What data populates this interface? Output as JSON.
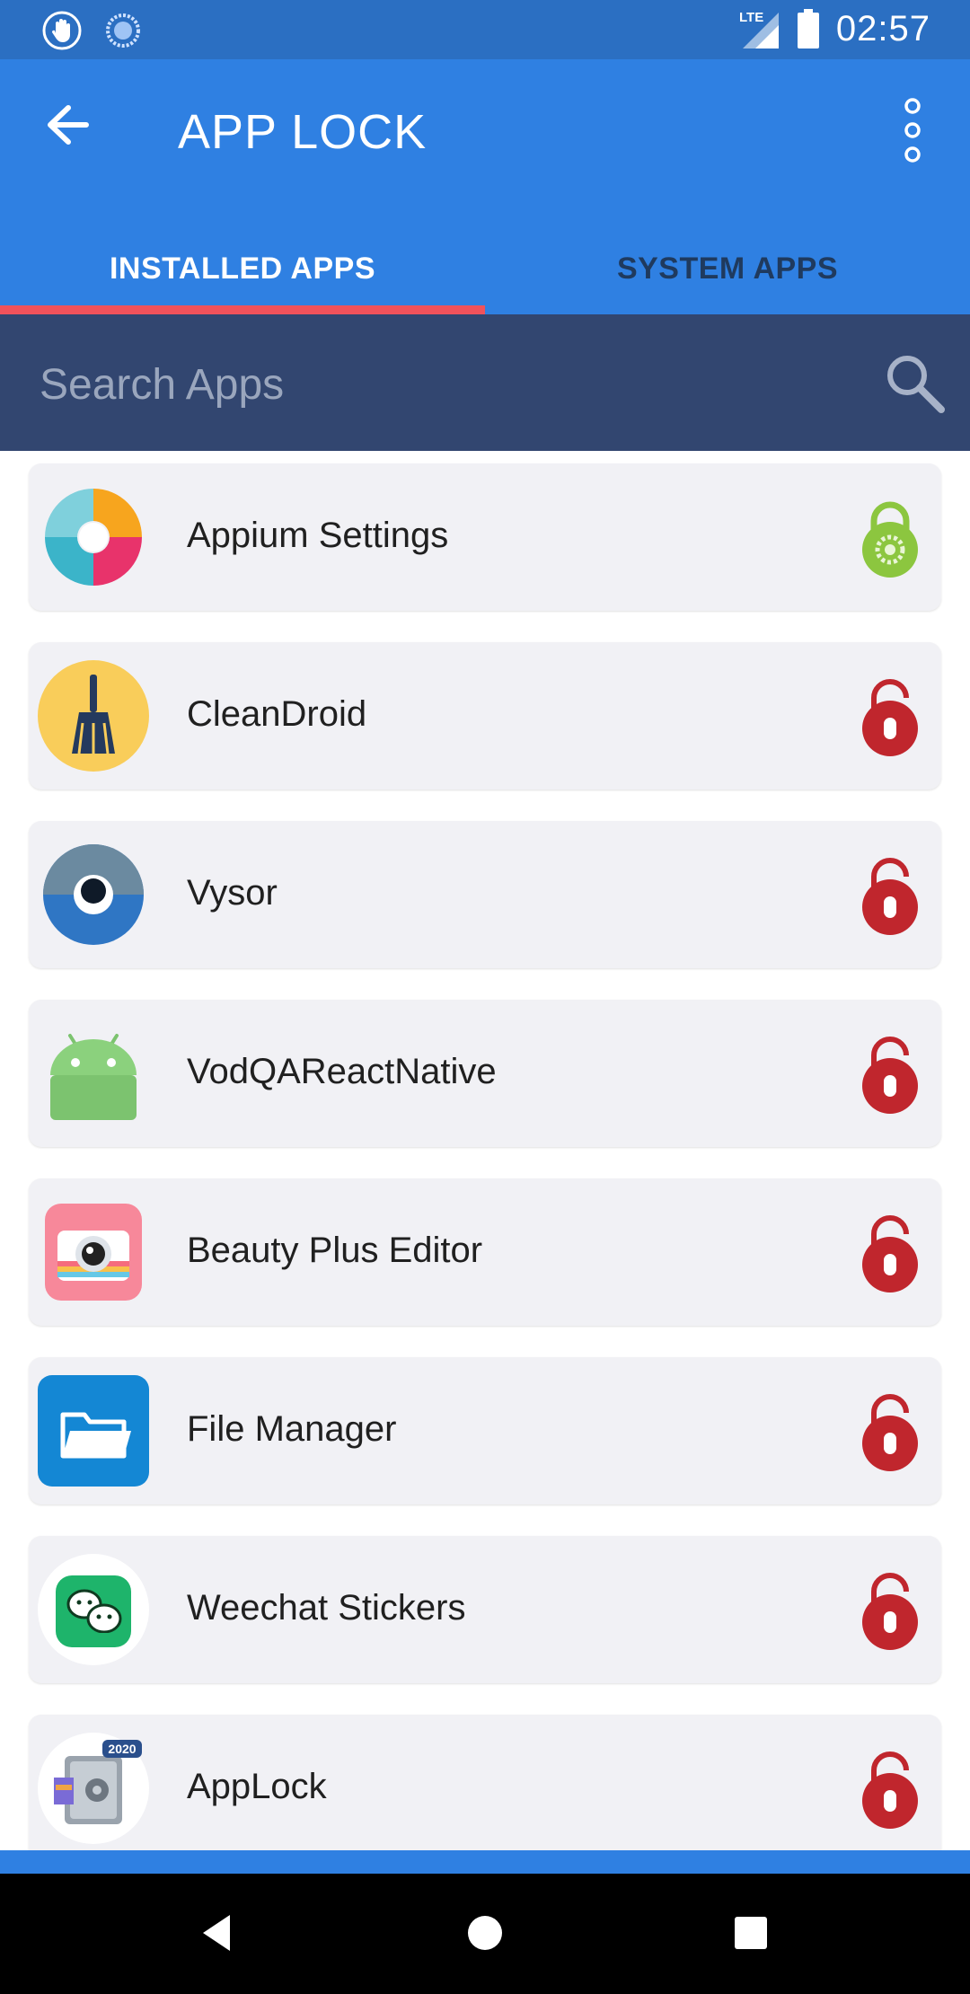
{
  "status_bar": {
    "network": "LTE",
    "time": "02:57",
    "icons": [
      "touch-hand-icon",
      "loading-sun-icon",
      "signal-icon",
      "battery-icon"
    ]
  },
  "app_bar": {
    "title": "APP LOCK",
    "back_icon": "arrow-back-icon",
    "menu_icon": "more-vertical-icon"
  },
  "tabs": [
    {
      "label": "INSTALLED APPS",
      "active": true
    },
    {
      "label": "SYSTEM APPS",
      "active": false
    }
  ],
  "search": {
    "placeholder": "Search Apps",
    "value": ""
  },
  "apps": [
    {
      "name": "Appium Settings",
      "icon": "appium-icon",
      "locked": true
    },
    {
      "name": "CleanDroid",
      "icon": "broom-icon",
      "locked": false
    },
    {
      "name": "Vysor",
      "icon": "vysor-eye-icon",
      "locked": false
    },
    {
      "name": "VodQAReactNative",
      "icon": "android-icon",
      "locked": false
    },
    {
      "name": "Beauty Plus Editor",
      "icon": "camera-icon",
      "locked": false
    },
    {
      "name": "File Manager",
      "icon": "folder-icon",
      "locked": false
    },
    {
      "name": "Weechat Stickers",
      "icon": "weechat-icon",
      "locked": false
    },
    {
      "name": "AppLock",
      "icon": "applock-safe-icon",
      "badge": "2020",
      "locked": false
    }
  ],
  "colors": {
    "status_bar": "#2b6fc2",
    "app_bar": "#2f80e2",
    "tab_indicator": "#f0525b",
    "search_bar": "#324670",
    "card": "#f1f1f5",
    "lock_locked": "#8cc63f",
    "lock_unlocked": "#c0262d"
  }
}
